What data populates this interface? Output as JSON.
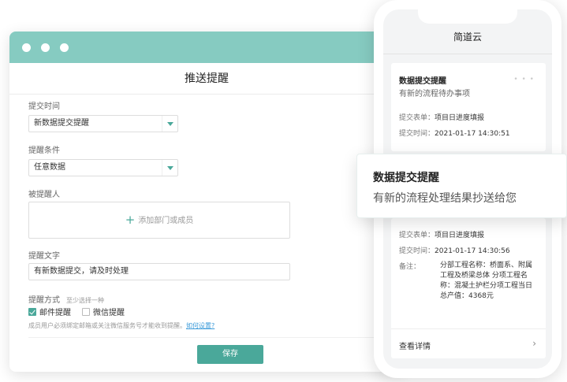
{
  "window": {
    "title": "推送提醒",
    "fields": {
      "submit_time_label": "提交时间",
      "submit_time_value": "新数据提交提醒",
      "condition_label": "提醒条件",
      "condition_value": "任意数据",
      "recipients_label": "被提醒人",
      "recipients_placeholder": "添加部门或成员",
      "text_label": "提醒文字",
      "text_value": "有新数据提交，请及时处理",
      "method_label": "提醒方式",
      "method_hint": "至少选择一种",
      "email_label": "邮件提醒",
      "email_checked": true,
      "wechat_label": "微信提醒",
      "wechat_checked": false,
      "notice": "成员用户必须绑定邮箱或关注微信服务号才能收到提醒。",
      "notice_link": "如何设置?"
    },
    "save_label": "保存"
  },
  "phone": {
    "app_title": "简道云",
    "card_top": {
      "title": "数据提交提醒",
      "subtitle": "有新的流程待办事项",
      "form_key": "提交表单：",
      "form_value": "项目日进度填报",
      "time_key": "提交时间：",
      "time_value": "2021-01-17 14:30:51"
    },
    "card_bottom": {
      "form_key": "提交表单：",
      "form_value": "项目日进度填报",
      "time_key": "提交时间：",
      "time_value": "2021-01-17 14:30:56",
      "note_key": "备注：",
      "note_value": "分部工程名称：桥面系、附属工程及桥梁总体 分项工程名称：混凝土护栏分项工程当日总产值：4368元",
      "detail_label": "查看详情"
    }
  },
  "popup": {
    "title": "数据提交提醒",
    "message": "有新的流程处理结果抄送给您"
  },
  "colors": {
    "accent": "#4aa89a",
    "titlebar": "#86cbc1",
    "link": "#3a9ad9"
  }
}
